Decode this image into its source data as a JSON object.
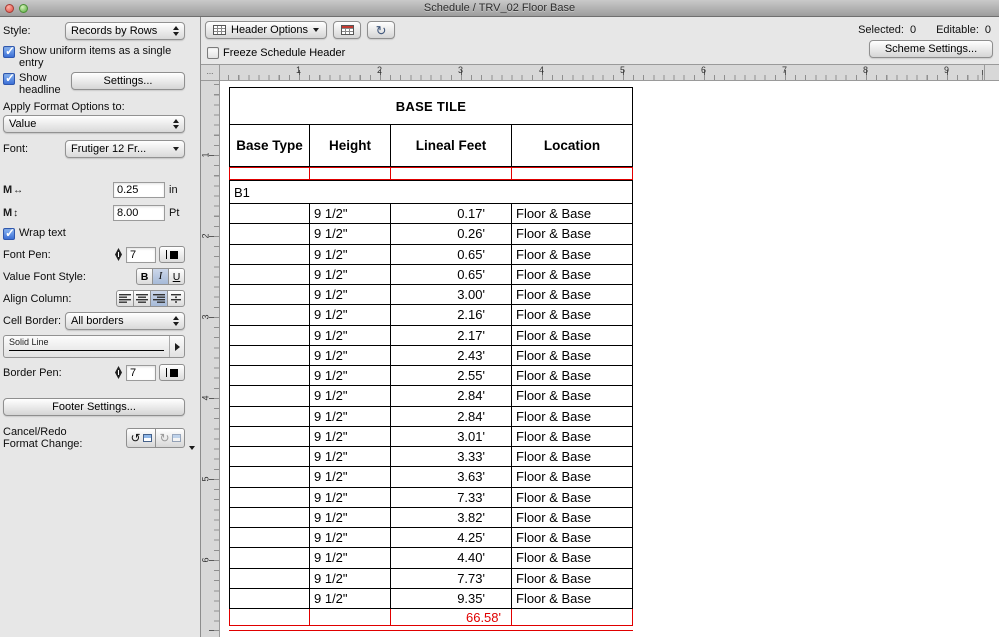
{
  "window": {
    "title": "Schedule / TRV_02 Floor Base"
  },
  "sidebar": {
    "style": {
      "label": "Style:",
      "value": "Records by Rows"
    },
    "show_uniform": "Show uniform items as a single entry",
    "show_headline": "Show headline",
    "settings_button": "Settings...",
    "apply_format": {
      "label": "Apply Format Options to:",
      "value": "Value"
    },
    "font": {
      "label": "Font:",
      "value": "Frutiger 12 Fr..."
    },
    "width_in": {
      "icon": "M",
      "arrow": "↔",
      "value": "0.25",
      "unit": "in"
    },
    "size_pt": {
      "icon": "M",
      "arrow": "↕",
      "value": "8.00",
      "unit": "Pt"
    },
    "wrap_text": "Wrap text",
    "font_pen": {
      "label": "Font Pen:",
      "value": "7"
    },
    "value_font_style": {
      "label": "Value Font Style:",
      "bold": "B",
      "italic": "I",
      "underline": "U"
    },
    "align_column_label": "Align Column:",
    "cell_border": {
      "label": "Cell Border:",
      "value": "All borders"
    },
    "line_style": "Solid Line",
    "border_pen": {
      "label": "Border Pen:",
      "value": "7"
    },
    "footer_button": "Footer Settings...",
    "cancel_redo": {
      "line1": "Cancel/Redo",
      "line2": "Format Change:",
      "undo_icon": "↺",
      "redo_icon": "↻"
    }
  },
  "toolbar": {
    "header_options": "Header Options",
    "freeze_header": "Freeze Schedule Header",
    "selected_label": "Selected:",
    "selected_value": "0",
    "editable_label": "Editable:",
    "editable_value": "0",
    "scheme_settings": "Scheme Settings...",
    "recalc_icon": "↻"
  },
  "ruler": {
    "corner": "...",
    "h_labels": [
      "1",
      "2",
      "3",
      "4",
      "5",
      "6",
      "7",
      "8",
      "9"
    ],
    "v_labels": [
      "1",
      "2",
      "3",
      "4",
      "5",
      "6"
    ]
  },
  "schedule": {
    "title": "BASE TILE",
    "columns": [
      "Base Type",
      "Height",
      "Lineal Feet",
      "Location"
    ],
    "group_label": "B1",
    "rows": [
      {
        "height": "9 1/2\"",
        "lineal_feet": "0.17'",
        "location": "Floor & Base"
      },
      {
        "height": "9 1/2\"",
        "lineal_feet": "0.26'",
        "location": "Floor & Base"
      },
      {
        "height": "9 1/2\"",
        "lineal_feet": "0.65'",
        "location": "Floor & Base"
      },
      {
        "height": "9 1/2\"",
        "lineal_feet": "0.65'",
        "location": "Floor & Base"
      },
      {
        "height": "9 1/2\"",
        "lineal_feet": "3.00'",
        "location": "Floor & Base"
      },
      {
        "height": "9 1/2\"",
        "lineal_feet": "2.16'",
        "location": "Floor & Base"
      },
      {
        "height": "9 1/2\"",
        "lineal_feet": "2.17'",
        "location": "Floor & Base"
      },
      {
        "height": "9 1/2\"",
        "lineal_feet": "2.43'",
        "location": "Floor & Base"
      },
      {
        "height": "9 1/2\"",
        "lineal_feet": "2.55'",
        "location": "Floor & Base"
      },
      {
        "height": "9 1/2\"",
        "lineal_feet": "2.84'",
        "location": "Floor & Base"
      },
      {
        "height": "9 1/2\"",
        "lineal_feet": "2.84'",
        "location": "Floor & Base"
      },
      {
        "height": "9 1/2\"",
        "lineal_feet": "3.01'",
        "location": "Floor & Base"
      },
      {
        "height": "9 1/2\"",
        "lineal_feet": "3.33'",
        "location": "Floor & Base"
      },
      {
        "height": "9 1/2\"",
        "lineal_feet": "3.63'",
        "location": "Floor & Base"
      },
      {
        "height": "9 1/2\"",
        "lineal_feet": "7.33'",
        "location": "Floor & Base"
      },
      {
        "height": "9 1/2\"",
        "lineal_feet": "3.82'",
        "location": "Floor & Base"
      },
      {
        "height": "9 1/2\"",
        "lineal_feet": "4.25'",
        "location": "Floor & Base"
      },
      {
        "height": "9 1/2\"",
        "lineal_feet": "4.40'",
        "location": "Floor & Base"
      },
      {
        "height": "9 1/2\"",
        "lineal_feet": "7.73'",
        "location": "Floor & Base"
      },
      {
        "height": "9 1/2\"",
        "lineal_feet": "9.35'",
        "location": "Floor & Base"
      }
    ],
    "total": "66.58'"
  }
}
